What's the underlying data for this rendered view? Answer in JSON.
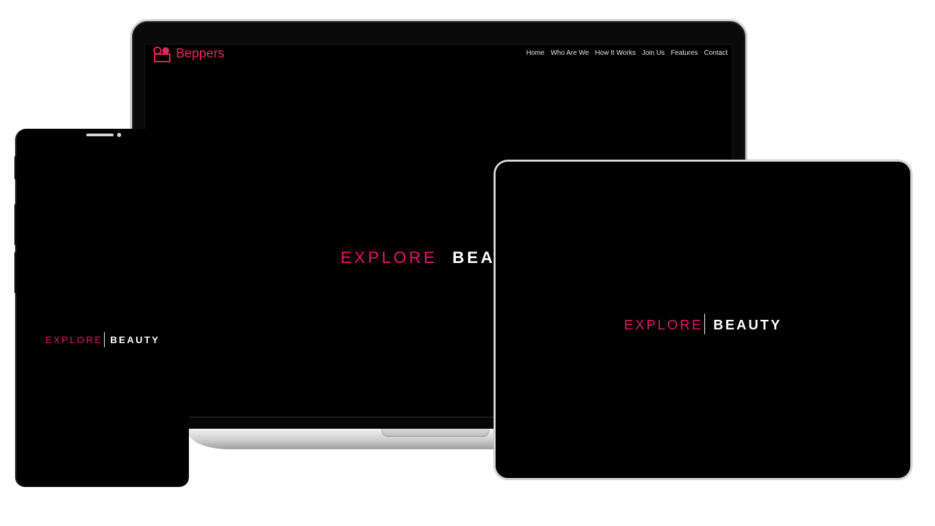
{
  "site": {
    "brand": "Beppers",
    "nav": [
      "Home",
      "Who Are We",
      "How It Works",
      "Join Us",
      "Features",
      "Contact"
    ]
  },
  "hero": {
    "word1": "EXPLORE",
    "word2": "BEAUTY",
    "laptop_word2": "BEAUTY"
  },
  "colors": {
    "accent": "#e3166a",
    "brand": "#e8275e",
    "background": "#000000"
  },
  "icons": {
    "logo": "beppers-logo-icon"
  }
}
